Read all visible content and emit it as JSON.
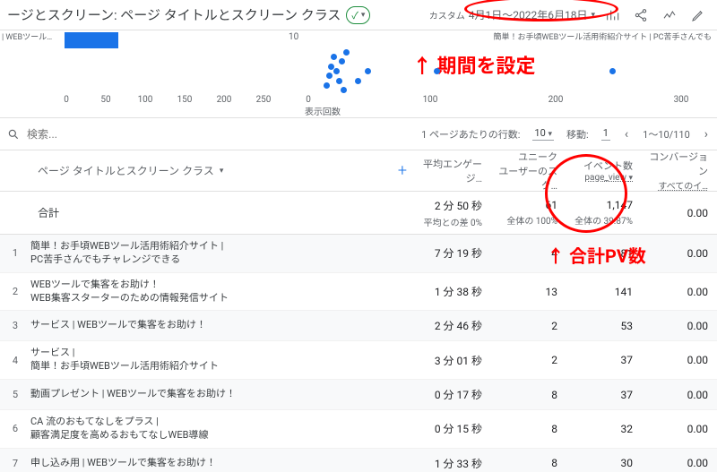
{
  "header": {
    "title_fragment": "ージとスクリーン: ページ タイトルとスクリーン クラス",
    "status": "✓",
    "date_prefix": "カスタム",
    "date_range": "4月1日～2022年6月18日",
    "toolbar_icons": [
      "compare-icon",
      "share-icon",
      "insight-icon",
      "edit-icon"
    ]
  },
  "annotations": {
    "period_arrow": "↑ 期間を設定",
    "pv_arrow": "↑ 合計PV数"
  },
  "chart_data": [
    {
      "type": "bar",
      "legend": "| WEBツール…",
      "x_ticks": [
        0,
        50,
        100,
        150,
        200,
        250
      ],
      "bars_y": [
        0,
        1
      ],
      "values": [
        48,
        8
      ]
    },
    {
      "type": "scatter",
      "legend": "簡単！お手頃WEBツール活用術紹介サイト | PC苦手さんでも",
      "xlabel": "表示回数",
      "x_ticks": [
        0,
        100,
        200,
        300
      ],
      "y_tick": 10,
      "points": [
        {
          "x": 12,
          "y": 3
        },
        {
          "x": 14,
          "y": 5
        },
        {
          "x": 16,
          "y": 7
        },
        {
          "x": 18,
          "y": 9
        },
        {
          "x": 20,
          "y": 6
        },
        {
          "x": 22,
          "y": 4
        },
        {
          "x": 24,
          "y": 8
        },
        {
          "x": 26,
          "y": 2
        },
        {
          "x": 28,
          "y": 10
        },
        {
          "x": 37,
          "y": 4
        },
        {
          "x": 45,
          "y": 6
        },
        {
          "x": 100,
          "y": 6
        },
        {
          "x": 240,
          "y": 6
        }
      ]
    }
  ],
  "controls": {
    "search_placeholder": "検索...",
    "rows_per_page_label": "1 ページあたりの行数:",
    "rows_per_page_value": "10",
    "goto_label": "移動:",
    "goto_value": "1",
    "page_range": "1～10/110"
  },
  "table": {
    "dimension_label": "ページ タイトルとスクリーン クラス",
    "columns": {
      "avg_engagement": "平均エンゲージ…",
      "unique_scroll": {
        "line1": "ユニーク",
        "line2": "ユーザーのスク…"
      },
      "events": {
        "label": "イベント数",
        "filter": "page_view"
      },
      "conversions": {
        "label": "コンバージョン",
        "filter": "すべてのイ…"
      }
    },
    "totals": {
      "label": "合計",
      "avg_engagement": {
        "main": "2 分 50 秒",
        "sub": "平均との差 0%"
      },
      "unique_scroll": {
        "main": "61",
        "sub": "全体の 100%"
      },
      "events": {
        "main": "1,147",
        "sub": "全体の 39.87%"
      },
      "conversions": {
        "main": "0.00",
        "sub": ""
      }
    },
    "rows": [
      {
        "idx": 1,
        "page": [
          "簡単！お手頃WEBツール活用術紹介サイト |",
          "PC苦手さんでもチャレンジできる"
        ],
        "avg": "7 分 19 秒",
        "uniq": "4",
        "ev": "81",
        "conv": "0.00"
      },
      {
        "idx": 2,
        "page": [
          "WEBツールで集客をお助け！",
          "WEB集客スターターのための情報発信サイト"
        ],
        "avg": "1 分 38 秒",
        "uniq": "13",
        "ev": "141",
        "conv": "0.00"
      },
      {
        "idx": 3,
        "page": [
          "サービス | WEBツールで集客をお助け！"
        ],
        "avg": "2 分 46 秒",
        "uniq": "2",
        "ev": "53",
        "conv": "0.00"
      },
      {
        "idx": 4,
        "page": [
          "サービス |",
          "簡単！お手頃WEBツール活用術紹介サイト"
        ],
        "avg": "3 分 01 秒",
        "uniq": "2",
        "ev": "37",
        "conv": "0.00"
      },
      {
        "idx": 5,
        "page": [
          "動画プレゼント | WEBツールで集客をお助け！"
        ],
        "avg": "0 分 17 秒",
        "uniq": "8",
        "ev": "37",
        "conv": "0.00"
      },
      {
        "idx": 6,
        "page": [
          "CA 流のおもてなしをプラス |",
          "顧客満足度を高めるおもてなしWEB導線"
        ],
        "avg": "0 分 15 秒",
        "uniq": "8",
        "ev": "32",
        "conv": "0.00"
      },
      {
        "idx": 7,
        "page": [
          "申し込み用 | WEBツールで集客をお助け！"
        ],
        "avg": "1 分 33 秒",
        "uniq": "8",
        "ev": "30",
        "conv": "0.00"
      }
    ]
  }
}
